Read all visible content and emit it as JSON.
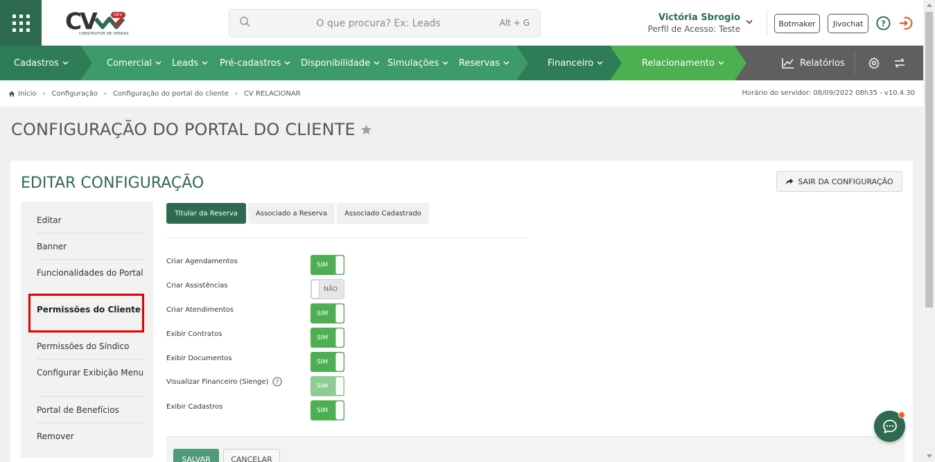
{
  "header": {
    "logo": {
      "main": "CV",
      "badge": "DEV",
      "subtitle": "CONSTRUTOR DE VENDAS"
    },
    "search": {
      "placeholder": "O que procura? Ex: Leads",
      "shortcut": "Alt + G"
    },
    "user": {
      "name": "Victória Sbrogio",
      "profile": "Perfil de Acesso: Teste"
    },
    "buttons": {
      "botmaker": "Botmaker",
      "jivochat": "Jivochat"
    }
  },
  "nav": {
    "items": [
      {
        "label": "Cadastros"
      },
      {
        "label": "Comercial"
      },
      {
        "label": "Leads"
      },
      {
        "label": "Pré-cadastros"
      },
      {
        "label": "Disponibilidade"
      },
      {
        "label": "Simulações"
      },
      {
        "label": "Reservas"
      },
      {
        "label": "Financeiro"
      },
      {
        "label": "Relacionamento"
      }
    ],
    "reports": "Relatórios",
    "colors": {
      "green_dark": "#2e7d57",
      "green": "#3d9a6a",
      "green_light": "#4caf50",
      "grey": "#5f5f5f"
    }
  },
  "breadcrumb": {
    "items": [
      "Início",
      "Configuração",
      "Configuração do portal do cliente",
      "CV RELACIONAR"
    ],
    "server_time": "Horário do servidor: 08/09/2022 08h35 - v10.4.30"
  },
  "page": {
    "title": "CONFIGURAÇÃO DO PORTAL DO CLIENTE"
  },
  "card": {
    "title": "EDITAR CONFIGURAÇÃO",
    "exit_button": "SAIR DA CONFIGURAÇÃO",
    "sidebar": [
      {
        "label": "Editar"
      },
      {
        "label": "Banner"
      },
      {
        "label": "Funcionalidades do Portal"
      },
      {
        "label": "Permissões do Cliente",
        "active": true
      },
      {
        "label": "Permissões do Síndico"
      },
      {
        "label": "Configurar Exibição Menu"
      },
      {
        "label": "Portal de Benefícios"
      },
      {
        "label": "Remover"
      }
    ],
    "tabs": [
      {
        "label": "Titular da Reserva",
        "active": true
      },
      {
        "label": "Associado a Reserva"
      },
      {
        "label": "Associado Cadastrado"
      }
    ],
    "permissions": [
      {
        "label": "Criar Agendamentos",
        "value": "SIM",
        "on": true
      },
      {
        "label": "Criar Assistências",
        "value": "NÃO",
        "on": false
      },
      {
        "label": "Criar Atendimentos",
        "value": "SIM",
        "on": true
      },
      {
        "label": "Exibir Contratos",
        "value": "SIM",
        "on": true
      },
      {
        "label": "Exibir Documentos",
        "value": "SIM",
        "on": true
      },
      {
        "label": "Visualizar Financeiro (Sienge)",
        "value": "SIM",
        "on": true,
        "disabled": true
      },
      {
        "label": "Exibir Cadastros",
        "value": "SIM",
        "on": true
      }
    ],
    "save_button": "SALVAR",
    "cancel_button": "CANCELAR"
  },
  "icons": {
    "grid": "apps-grid-icon",
    "search": "search-icon",
    "help": "help-circle-icon",
    "exit": "logout-icon",
    "chart": "line-chart-icon",
    "gear": "gear-icon",
    "swap": "swap-arrows-icon",
    "home": "home-icon",
    "star": "star-icon",
    "share": "share-arrow-icon",
    "chat": "chat-bubble-icon"
  }
}
